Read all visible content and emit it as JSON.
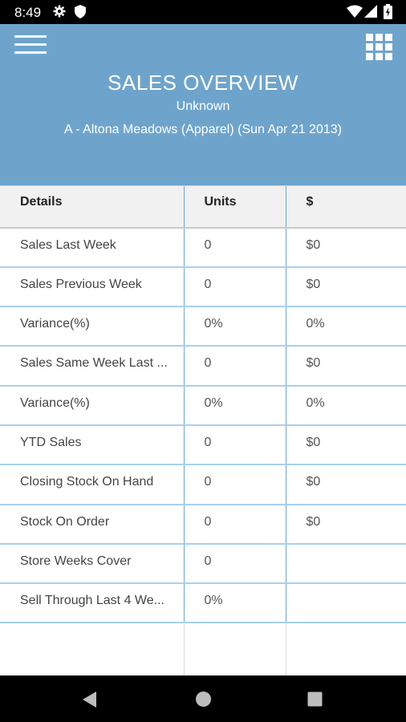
{
  "status_bar": {
    "time": "8:49"
  },
  "header": {
    "title": "SALES OVERVIEW",
    "subtitle": "Unknown",
    "store": "A - Altona Meadows (Apparel) (Sun Apr 21 2013)",
    "background_color": "#6ea4cb"
  },
  "table": {
    "columns": [
      "Details",
      "Units",
      "$"
    ],
    "rows": [
      {
        "details": "Sales Last Week",
        "units": "0",
        "dollars": "$0"
      },
      {
        "details": "Sales Previous Week",
        "units": "0",
        "dollars": "$0"
      },
      {
        "details": "Variance(%)",
        "units": "0%",
        "dollars": "0%"
      },
      {
        "details": "Sales Same Week Last ...",
        "units": "0",
        "dollars": "$0"
      },
      {
        "details": "Variance(%)",
        "units": "0%",
        "dollars": "0%"
      },
      {
        "details": "YTD Sales",
        "units": "0",
        "dollars": "$0"
      },
      {
        "details": "Closing Stock On Hand",
        "units": "0",
        "dollars": "$0"
      },
      {
        "details": "Stock On Order",
        "units": "0",
        "dollars": "$0"
      },
      {
        "details": "Store Weeks Cover",
        "units": "0",
        "dollars": ""
      },
      {
        "details": "Sell Through Last 4 We...",
        "units": "0%",
        "dollars": ""
      }
    ]
  },
  "icons": {
    "menu": "hamburger-menu-icon",
    "apps": "grid-apps-icon",
    "status": [
      "gear-icon",
      "shield-icon",
      "wifi-icon",
      "signal-icon",
      "battery-icon"
    ],
    "nav": [
      "back-icon",
      "home-icon",
      "recents-icon"
    ]
  }
}
